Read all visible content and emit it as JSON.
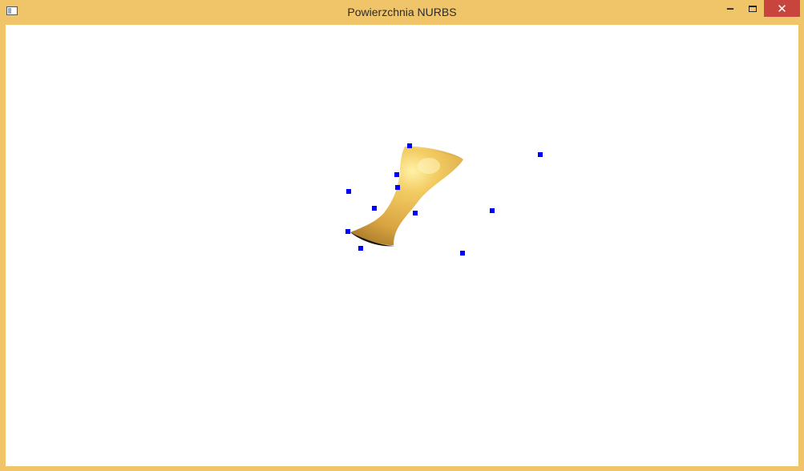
{
  "window": {
    "title": "Powierzchnia NURBS",
    "controls": {
      "minimize": "‒",
      "close": "✕"
    }
  },
  "scene": {
    "surface_color": "#e8b54a",
    "control_point_color": "#0000ff",
    "background": "#ffffff"
  }
}
